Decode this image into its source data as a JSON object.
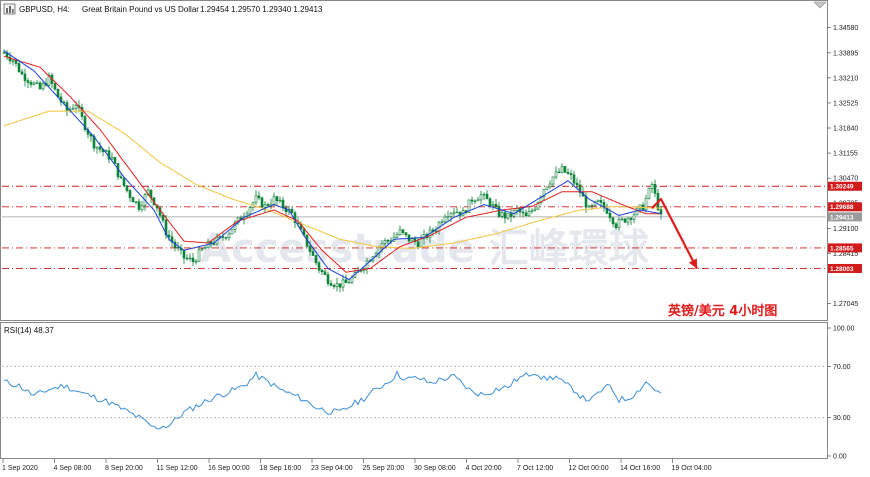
{
  "header": {
    "symbol": "GBPUSD, H4:",
    "description": "Great Britain Pound vs US Dollar",
    "ohlc": "1.29454 1.29570 1.29340 1.29413"
  },
  "annotation_text": "英镑/美元  4小时图",
  "watermark_text": "Accesstrade 汇峰環球",
  "colors": {
    "bull": "#0b8a3a",
    "bear": "#0b8a3a",
    "ma_fast": "#1a3fd6",
    "ma_mid": "#e02020",
    "ma_slow": "#f2c94c",
    "level_line": "#d11a1a",
    "current_price_line": "#9a9a9a",
    "rsi_line": "#3c8fd8",
    "arrow": "#e01b1b"
  },
  "icons": [
    "chart-menu-icon",
    "window-collapse-icon"
  ],
  "price_axis_ticks": [
    "1.34580",
    "1.33895",
    "1.33210",
    "1.32525",
    "1.31840",
    "1.31155",
    "1.30470",
    "1.29785",
    "1.29100",
    "1.28415",
    "1.27045"
  ],
  "level_chips": [
    "1.30249",
    "1.29688",
    "1.29413",
    "1.28565",
    "1.28003"
  ],
  "rsi": {
    "label": "RSI(14) 48.37",
    "axis_ticks": [
      "100.00",
      "70.00",
      "30.00",
      "0.00"
    ]
  },
  "time_axis_labels": [
    "1 Sep 2020",
    "4 Sep 08:00",
    "8 Sep 20:00",
    "11 Sep 12:00",
    "16 Sep 00:00",
    "18 Sep 16:00",
    "23 Sep 04:00",
    "25 Sep 20:00",
    "30 Sep 08:00",
    "4 Oct 20:00",
    "7 Oct 12:00",
    "12 Oct 00:00",
    "14 Oct 16:00",
    "19 Oct 04:00"
  ],
  "chart_data": {
    "type": "candlestick",
    "symbol": "GBPUSD",
    "timeframe": "H4",
    "ylim": [
      1.2665,
      1.349
    ],
    "levels": [
      1.30249,
      1.29688,
      1.28565,
      1.28003
    ],
    "current_price": 1.29413,
    "close_path": [
      [
        0,
        1.339
      ],
      [
        3,
        1.337
      ],
      [
        6,
        1.333
      ],
      [
        9,
        1.331
      ],
      [
        12,
        1.329
      ],
      [
        15,
        1.332
      ],
      [
        18,
        1.327
      ],
      [
        21,
        1.323
      ],
      [
        24,
        1.325
      ],
      [
        27,
        1.319
      ],
      [
        30,
        1.314
      ],
      [
        33,
        1.312
      ],
      [
        36,
        1.31
      ],
      [
        39,
        1.304
      ],
      [
        42,
        1.3
      ],
      [
        45,
        1.297
      ],
      [
        48,
        1.301
      ],
      [
        51,
        1.297
      ],
      [
        54,
        1.29
      ],
      [
        57,
        1.286
      ],
      [
        60,
        1.283
      ],
      [
        63,
        1.282
      ],
      [
        66,
        1.285
      ],
      [
        69,
        1.287
      ],
      [
        72,
        1.288
      ],
      [
        75,
        1.29
      ],
      [
        78,
        1.293
      ],
      [
        81,
        1.296
      ],
      [
        84,
        1.299
      ],
      [
        87,
        1.297
      ],
      [
        90,
        1.299
      ],
      [
        93,
        1.297
      ],
      [
        96,
        1.295
      ],
      [
        99,
        1.29
      ],
      [
        102,
        1.285
      ],
      [
        105,
        1.28
      ],
      [
        108,
        1.277
      ],
      [
        111,
        1.2755
      ],
      [
        114,
        1.276
      ],
      [
        117,
        1.278
      ],
      [
        120,
        1.281
      ],
      [
        123,
        1.284
      ],
      [
        126,
        1.287
      ],
      [
        129,
        1.288
      ],
      [
        132,
        1.29
      ],
      [
        135,
        1.288
      ],
      [
        138,
        1.287
      ],
      [
        141,
        1.289
      ],
      [
        144,
        1.291
      ],
      [
        147,
        1.295
      ],
      [
        150,
        1.296
      ],
      [
        153,
        1.295
      ],
      [
        156,
        1.299
      ],
      [
        159,
        1.3
      ],
      [
        162,
        1.298
      ],
      [
        165,
        1.295
      ],
      [
        168,
        1.294
      ],
      [
        171,
        1.296
      ],
      [
        174,
        1.294
      ],
      [
        177,
        1.297
      ],
      [
        180,
        1.302
      ],
      [
        183,
        1.305
      ],
      [
        186,
        1.307
      ],
      [
        189,
        1.305
      ],
      [
        192,
        1.301
      ],
      [
        195,
        1.296
      ],
      [
        198,
        1.298
      ],
      [
        201,
        1.296
      ],
      [
        204,
        1.292
      ],
      [
        207,
        1.2935
      ],
      [
        210,
        1.295
      ],
      [
        213,
        1.297
      ],
      [
        216,
        1.303
      ],
      [
        219,
        1.294
      ]
    ],
    "ma_fast_path": [
      [
        0,
        1.3395
      ],
      [
        10,
        1.334
      ],
      [
        20,
        1.325
      ],
      [
        30,
        1.316
      ],
      [
        40,
        1.305
      ],
      [
        50,
        1.296
      ],
      [
        55,
        1.288
      ],
      [
        60,
        1.285
      ],
      [
        70,
        1.287
      ],
      [
        80,
        1.294
      ],
      [
        90,
        1.2975
      ],
      [
        95,
        1.296
      ],
      [
        100,
        1.289
      ],
      [
        108,
        1.28
      ],
      [
        115,
        1.277
      ],
      [
        122,
        1.282
      ],
      [
        130,
        1.288
      ],
      [
        140,
        1.2885
      ],
      [
        150,
        1.294
      ],
      [
        160,
        1.2975
      ],
      [
        170,
        1.295
      ],
      [
        180,
        1.3
      ],
      [
        188,
        1.304
      ],
      [
        195,
        1.299
      ],
      [
        205,
        1.2945
      ],
      [
        212,
        1.296
      ],
      [
        219,
        1.295
      ]
    ],
    "ma_mid_path": [
      [
        0,
        1.338
      ],
      [
        12,
        1.335
      ],
      [
        22,
        1.327
      ],
      [
        32,
        1.318
      ],
      [
        42,
        1.307
      ],
      [
        52,
        1.296
      ],
      [
        60,
        1.2875
      ],
      [
        68,
        1.287
      ],
      [
        78,
        1.293
      ],
      [
        90,
        1.296
      ],
      [
        98,
        1.293
      ],
      [
        106,
        1.285
      ],
      [
        114,
        1.279
      ],
      [
        122,
        1.28
      ],
      [
        132,
        1.286
      ],
      [
        142,
        1.289
      ],
      [
        154,
        1.294
      ],
      [
        166,
        1.296
      ],
      [
        176,
        1.297
      ],
      [
        186,
        1.301
      ],
      [
        196,
        1.301
      ],
      [
        206,
        1.2975
      ],
      [
        214,
        1.295
      ],
      [
        219,
        1.295
      ]
    ],
    "ma_slow_path": [
      [
        0,
        1.319
      ],
      [
        15,
        1.323
      ],
      [
        28,
        1.323
      ],
      [
        40,
        1.317
      ],
      [
        52,
        1.309
      ],
      [
        64,
        1.303
      ],
      [
        76,
        1.299
      ],
      [
        88,
        1.296
      ],
      [
        100,
        1.292
      ],
      [
        112,
        1.288
      ],
      [
        124,
        1.286
      ],
      [
        136,
        1.2855
      ],
      [
        150,
        1.287
      ],
      [
        164,
        1.2895
      ],
      [
        178,
        1.293
      ],
      [
        192,
        1.296
      ],
      [
        204,
        1.297
      ],
      [
        219,
        1.2965
      ]
    ],
    "forecast_arrow": [
      [
        216,
        1.2965
      ],
      [
        219,
        1.299
      ],
      [
        231,
        1.28
      ]
    ],
    "rsi_series": {
      "ylim": [
        0,
        100
      ],
      "levels": [
        70,
        30
      ],
      "last_value": 48.37,
      "path": [
        [
          0,
          58
        ],
        [
          5,
          55
        ],
        [
          10,
          47
        ],
        [
          15,
          52
        ],
        [
          20,
          55
        ],
        [
          25,
          50
        ],
        [
          30,
          46
        ],
        [
          35,
          42
        ],
        [
          40,
          36
        ],
        [
          45,
          30
        ],
        [
          50,
          22
        ],
        [
          55,
          24
        ],
        [
          60,
          34
        ],
        [
          65,
          40
        ],
        [
          70,
          46
        ],
        [
          75,
          50
        ],
        [
          80,
          55
        ],
        [
          84,
          63
        ],
        [
          88,
          58
        ],
        [
          92,
          52
        ],
        [
          96,
          48
        ],
        [
          100,
          44
        ],
        [
          104,
          38
        ],
        [
          108,
          35
        ],
        [
          112,
          34
        ],
        [
          116,
          40
        ],
        [
          120,
          45
        ],
        [
          124,
          52
        ],
        [
          128,
          58
        ],
        [
          131,
          64
        ],
        [
          134,
          60
        ],
        [
          138,
          61
        ],
        [
          142,
          57
        ],
        [
          146,
          60
        ],
        [
          150,
          62
        ],
        [
          153,
          56
        ],
        [
          156,
          50
        ],
        [
          160,
          48
        ],
        [
          164,
          52
        ],
        [
          168,
          54
        ],
        [
          171,
          60
        ],
        [
          174,
          63
        ],
        [
          177,
          66
        ],
        [
          180,
          60
        ],
        [
          184,
          62
        ],
        [
          187,
          56
        ],
        [
          190,
          52
        ],
        [
          193,
          45
        ],
        [
          196,
          44
        ],
        [
          199,
          51
        ],
        [
          202,
          55
        ],
        [
          205,
          44
        ],
        [
          208,
          45
        ],
        [
          211,
          50
        ],
        [
          214,
          58
        ],
        [
          217,
          52
        ],
        [
          219,
          48
        ]
      ]
    }
  }
}
